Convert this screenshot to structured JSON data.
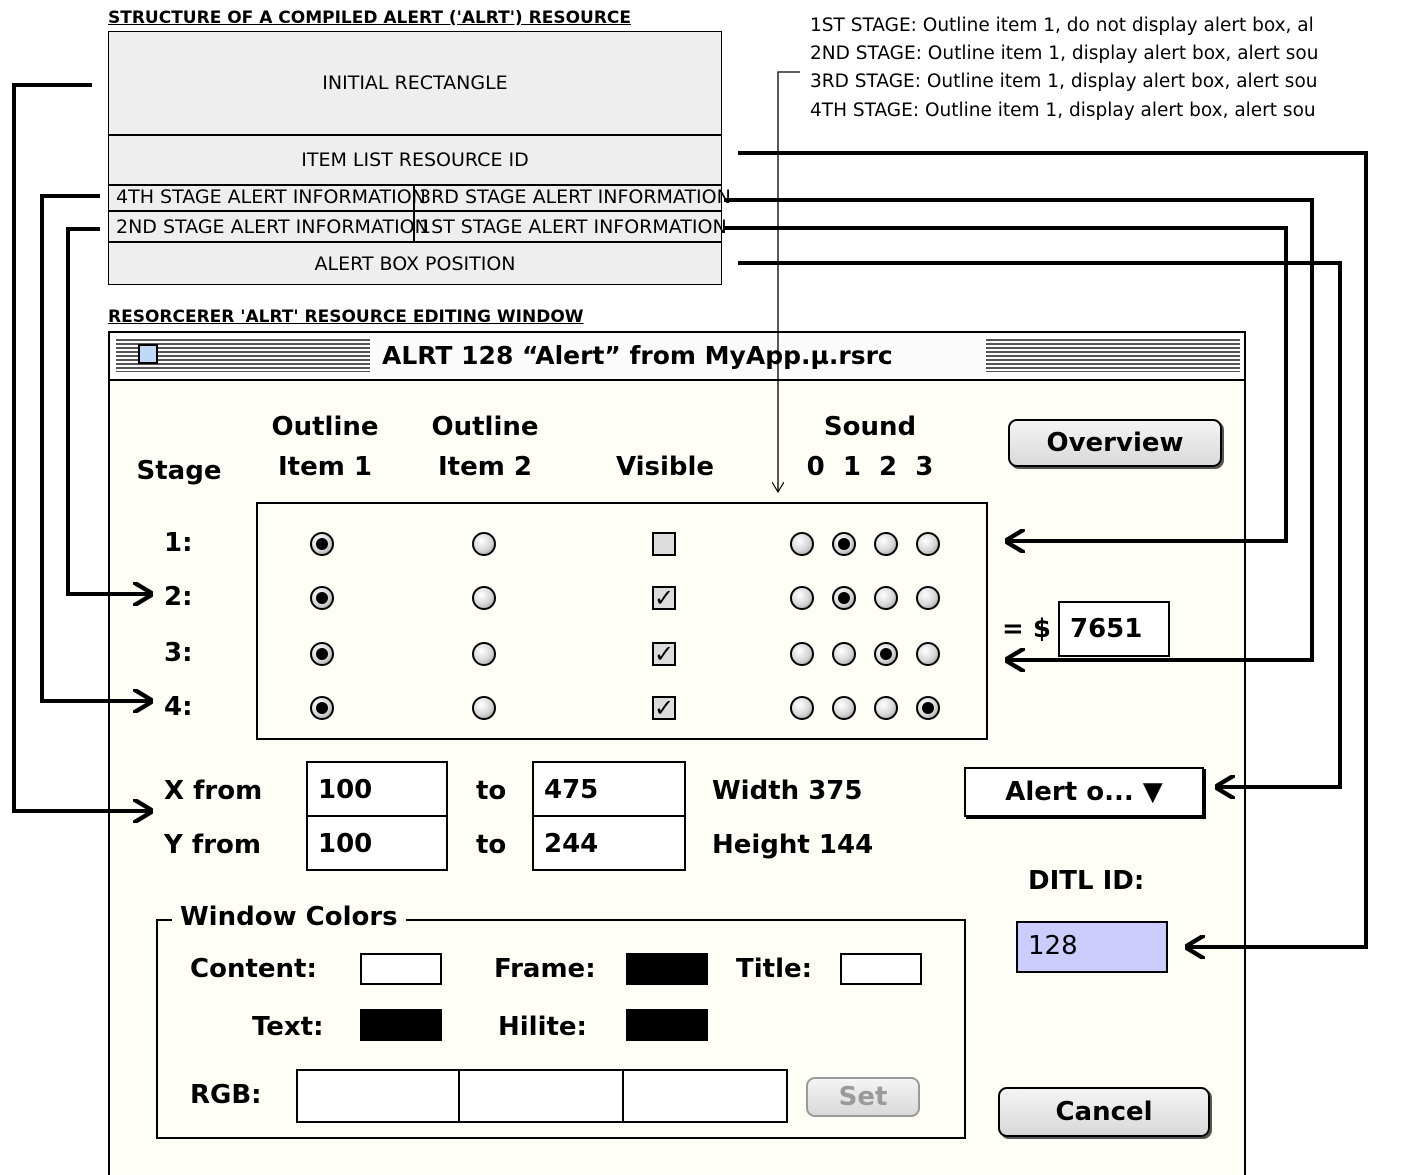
{
  "structure": {
    "header": "STRUCTURE OF A COMPILED ALERT ('ALRT') RESOURCE",
    "initial_rect": "INITIAL RECTANGLE",
    "item_list_id": "ITEM LIST RESOURCE ID",
    "stage4_info": "4TH STAGE ALERT INFORMATION",
    "stage3_info": "3RD STAGE ALERT INFORMATION",
    "stage2_info": "2ND STAGE ALERT INFORMATION",
    "stage1_info": "1ST STAGE ALERT INFORMATION",
    "alert_box_position": "ALERT BOX POSITION"
  },
  "stage_notes": [
    "1ST STAGE:  Outline item 1, do not display alert box, al",
    "2ND STAGE:  Outline item 1, display alert box, alert sou",
    "3RD STAGE:  Outline item 1, display alert box, alert sou",
    "4TH STAGE:  Outline item 1, display alert box, alert sou"
  ],
  "editor": {
    "header": "RESORCERER 'ALRT' RESOURCE EDITING WINDOW",
    "window_title": "ALRT 128 “Alert” from MyApp.µ.rsrc",
    "col_stage": "Stage",
    "col_outline1_l1": "Outline",
    "col_outline1_l2": "Item 1",
    "col_outline2_l1": "Outline",
    "col_outline2_l2": "Item 2",
    "col_visible": "Visible",
    "col_sound": "Sound",
    "col_sound_nums": "0  1  2  3",
    "overview_button": "Overview",
    "rows": [
      {
        "label": "1:",
        "outline1": true,
        "outline2": false,
        "visible": false,
        "sound": 1
      },
      {
        "label": "2:",
        "outline1": true,
        "outline2": false,
        "visible": true,
        "sound": 1
      },
      {
        "label": "3:",
        "outline1": true,
        "outline2": false,
        "visible": true,
        "sound": 2
      },
      {
        "label": "4:",
        "outline1": true,
        "outline2": false,
        "visible": true,
        "sound": 3
      }
    ],
    "hex_label": "= $",
    "hex_value": "7651",
    "x_from_label": "X from",
    "x_from": "100",
    "x_to_label": "to",
    "x_to": "475",
    "width_label": "Width 375",
    "y_from_label": "Y from",
    "y_from": "100",
    "y_to_label": "to",
    "y_to": "244",
    "height_label": "Height 144",
    "position_popup": "Alert o... ▼",
    "ditl_label": "DITL ID:",
    "ditl_value": "128",
    "colors_group": "Window Colors",
    "content_label": "Content:",
    "frame_label": "Frame:",
    "title_label": "Title:",
    "text_label": "Text:",
    "hilite_label": "Hilite:",
    "rgb_label": "RGB:",
    "set_button": "Set",
    "cancel_button": "Cancel",
    "swatch_colors": {
      "content": "#ffffff",
      "frame": "#000000",
      "title": "#ffffff",
      "text": "#000000",
      "hilite": "#000000"
    },
    "ditl_highlight": "#ccccff"
  }
}
